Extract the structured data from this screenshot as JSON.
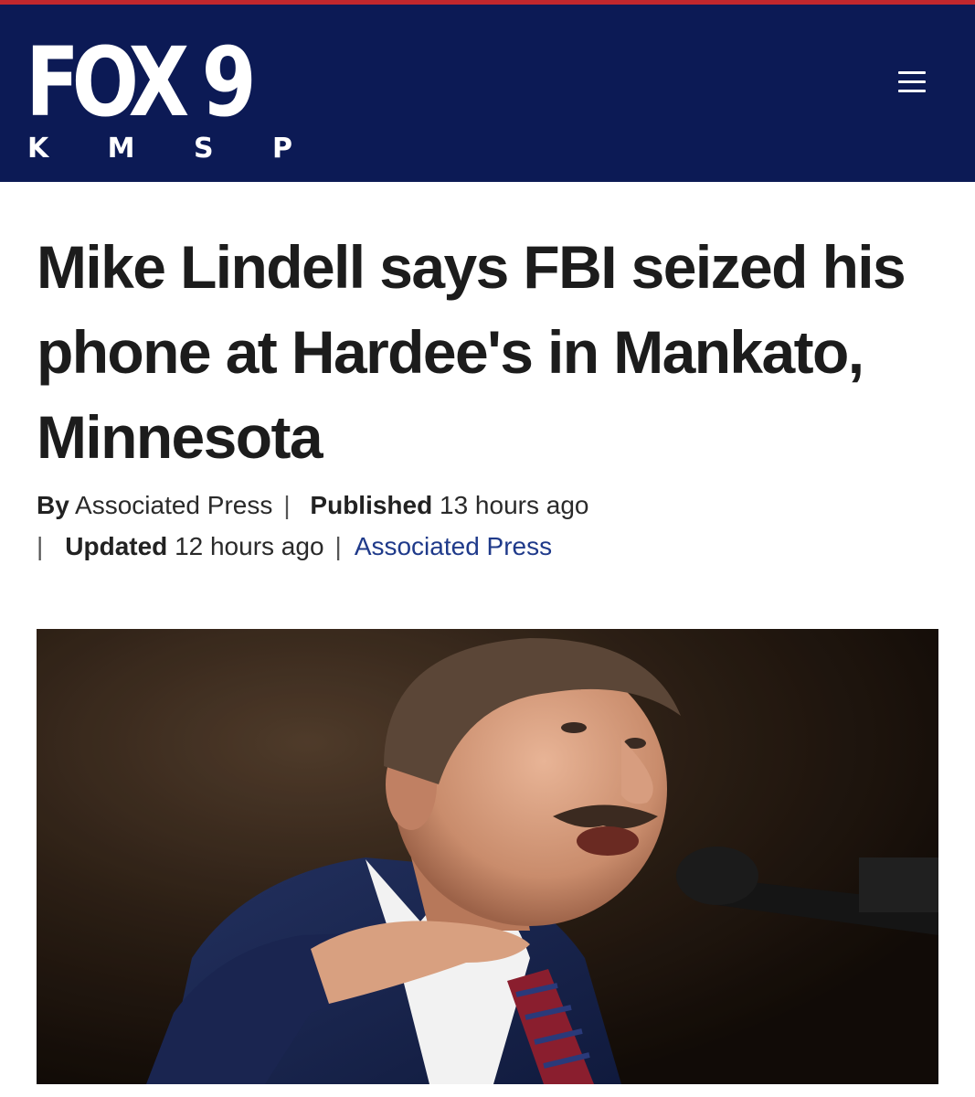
{
  "brand": {
    "logo_main": "FOX 9",
    "logo_sub_letters": [
      "K",
      "M",
      "S",
      "P"
    ],
    "colors": {
      "header_bg": "#0c1a55",
      "accent_line": "#c1272d",
      "link": "#1f3a8a"
    }
  },
  "header": {
    "menu_icon": "hamburger-menu-icon"
  },
  "article": {
    "headline": "Mike Lindell says FBI seized his phone at Hardee's in Mankato, Minnesota",
    "byline": {
      "by_label": "By",
      "author": "Associated Press",
      "published_label": "Published",
      "published_value": "13 hours ago",
      "updated_label": "Updated",
      "updated_value": "12 hours ago",
      "source_link": "Associated Press"
    },
    "hero_image": {
      "subject": "man in navy suit speaking at a microphone, arm outstretched"
    }
  }
}
